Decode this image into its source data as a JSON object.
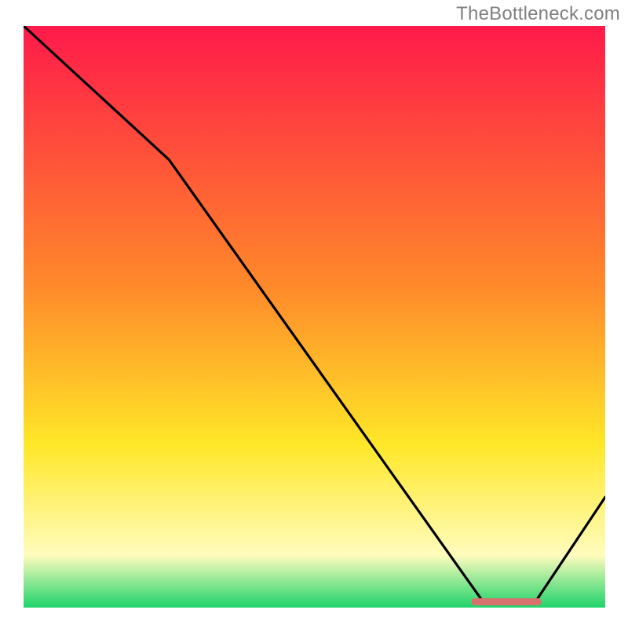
{
  "attribution": "TheBottleneck.com",
  "colors": {
    "grad_red": "#ff1a4a",
    "grad_orange": "#ff8a2a",
    "grad_yellow": "#ffe728",
    "grad_pale": "#fffcbd",
    "grad_green": "#1fd36a",
    "curve": "#000000",
    "marker": "#d9716e"
  },
  "chart_data": {
    "type": "line",
    "title": "",
    "xlabel": "",
    "ylabel": "",
    "xlim": [
      0,
      100
    ],
    "ylim": [
      0,
      100
    ],
    "series": [
      {
        "name": "bottleneck-curve",
        "x": [
          0,
          25,
          79,
          88,
          100
        ],
        "values": [
          100,
          77,
          1,
          1,
          19
        ]
      }
    ],
    "marker": {
      "name": "optimal-range",
      "x_start": 77,
      "x_end": 89,
      "y": 1
    },
    "gradient_stops_pct": {
      "red": 0,
      "orange": 45,
      "yellow": 72,
      "pale": 91,
      "green": 100
    }
  }
}
